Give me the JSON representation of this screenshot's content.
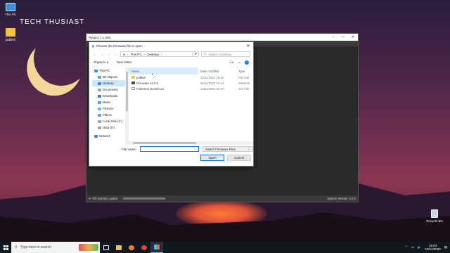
{
  "desktop": {
    "brand": "TECH THUSIAST",
    "icons": [
      {
        "label": "This PC"
      },
      {
        "label": "publish"
      },
      {
        "label": "Recycle Bin"
      }
    ]
  },
  "ryujinx": {
    "title": "Ryujinx 1.1.365",
    "status_left": "0/0 Games Loaded",
    "status_right": "System Version: 0.0.0"
  },
  "dialog": {
    "title": "Choose the firmware file to open",
    "breadcrumb": [
      "This PC",
      "Desktop"
    ],
    "search_placeholder": "Search Desktop",
    "toolbar": {
      "organize": "Organize ▾",
      "new_folder": "New folder"
    },
    "nav_items": [
      {
        "label": "This PC",
        "sub": false,
        "color": "#3b8de0"
      },
      {
        "label": "3D Objects",
        "sub": true,
        "color": "#5aa0e6"
      },
      {
        "label": "Desktop",
        "sub": true,
        "color": "#3b8de0",
        "selected": true
      },
      {
        "label": "Documents",
        "sub": true,
        "color": "#8fa4b8"
      },
      {
        "label": "Downloads",
        "sub": true,
        "color": "#2f7fd3"
      },
      {
        "label": "Music",
        "sub": true,
        "color": "#5aa0e6"
      },
      {
        "label": "Pictures",
        "sub": true,
        "color": "#6bb0e8"
      },
      {
        "label": "Videos",
        "sub": true,
        "color": "#5aa0e6"
      },
      {
        "label": "Local Disk (C:)",
        "sub": true,
        "color": "#9aa8b4"
      },
      {
        "label": "Data (D:)",
        "sub": true,
        "color": "#9aa8b4"
      },
      {
        "label": "Network",
        "sub": false,
        "color": "#3b8de0"
      }
    ],
    "columns": {
      "name": "Name",
      "date": "Date modified",
      "type": "Type"
    },
    "files": [
      {
        "name": "publish",
        "date": "10/11/2022 15:03",
        "type": "File fold",
        "icon": "folder"
      },
      {
        "name": "Firmware 15.0.0",
        "date": "05/11/2022 10:24",
        "type": "WinRAR",
        "icon": "dark"
      },
      {
        "name": "Pokemon Scarlet.xci",
        "date": "10/11/2022 01:27",
        "type": "XCI File",
        "icon": "doc"
      }
    ],
    "filename_label": "File name:",
    "filename_value": "",
    "filter": "Switch Firmware Files",
    "open_label": "Open",
    "cancel_label": "Cancel"
  },
  "taskbar": {
    "search_placeholder": "Type here to search",
    "time": "15:04",
    "date": "10/11/2022"
  }
}
